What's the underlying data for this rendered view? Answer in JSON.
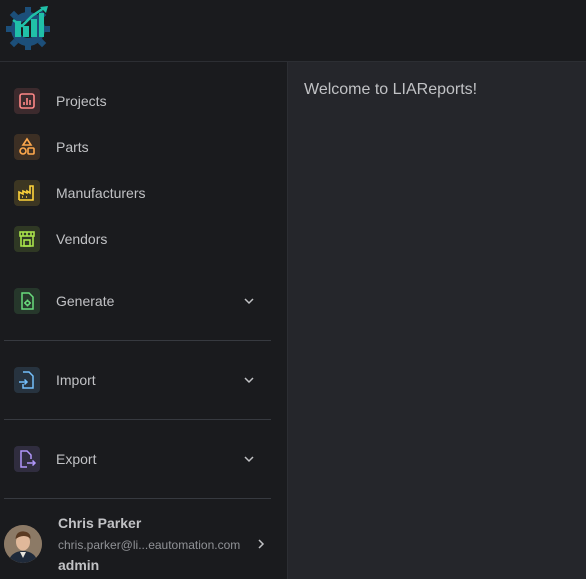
{
  "app": {
    "logo_icon": "liareports-logo-icon"
  },
  "nav": {
    "items": [
      {
        "label": "Projects",
        "icon": "bar-chart-icon",
        "color": "#ff8787"
      },
      {
        "label": "Parts",
        "icon": "shapes-icon",
        "color": "#ffa94d"
      },
      {
        "label": "Manufacturers",
        "icon": "factory-icon",
        "color": "#ffd43b"
      },
      {
        "label": "Vendors",
        "icon": "storefront-icon",
        "color": "#a9e34b"
      }
    ],
    "groups": [
      {
        "label": "Generate",
        "icon": "file-settings-icon",
        "color": "#69db7c"
      },
      {
        "label": "Import",
        "icon": "file-import-icon",
        "color": "#74c0fc"
      },
      {
        "label": "Export",
        "icon": "file-export-icon",
        "color": "#b197fc"
      }
    ]
  },
  "user": {
    "name": "Chris Parker",
    "email": "chris.parker@li...eautomation.com",
    "role": "admin"
  },
  "main": {
    "welcome": "Welcome to LIAReports!"
  }
}
